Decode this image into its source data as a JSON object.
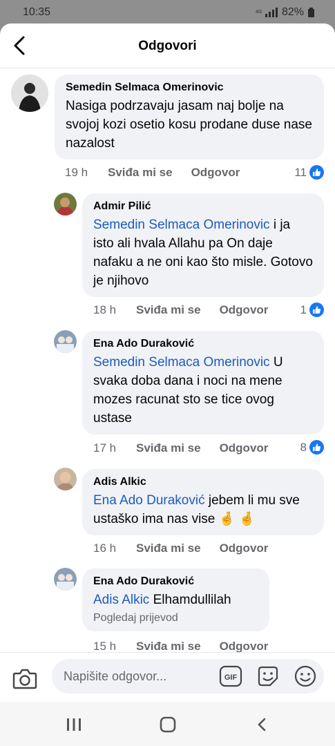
{
  "status_bar": {
    "time": "10:35",
    "battery": "82%"
  },
  "header": {
    "title": "Odgovori"
  },
  "comments": [
    {
      "name": "Semedin Selmaca Omerinovic",
      "text": "Nasiga podrzavaju jasam naj bolje na svojoj kozi osetio  kosu prodane duse nase  nazalost",
      "time": "19 h",
      "like_label": "Sviđa mi se",
      "reply_label": "Odgovor",
      "reactions": "11"
    },
    {
      "name": "Admir Pilić",
      "mention": "Semedin Selmaca Omerinovic",
      "text": " i ja isto ali hvala Allahu pa On daje nafaku a ne oni kao što misle. Gotovo je njihovo",
      "time": "18 h",
      "like_label": "Sviđa mi se",
      "reply_label": "Odgovor",
      "reactions": "1"
    },
    {
      "name": "Ena Ado Duraković",
      "mention": "Semedin Selmaca Omerinovic",
      "text": " U svaka doba dana i noci na mene mozes racunat sto se tice ovog ustase",
      "time": "17 h",
      "like_label": "Sviđa mi se",
      "reply_label": "Odgovor",
      "reactions": "8"
    },
    {
      "name": "Adis Alkic",
      "mention": "Ena Ado Duraković",
      "text": " jebem li mu sve ustaško ima nas vise",
      "emoji": "🤞 🤞",
      "time": "16 h",
      "like_label": "Sviđa mi se",
      "reply_label": "Odgovor"
    },
    {
      "name": "Ena Ado Duraković",
      "mention": "Adis Alkic",
      "text": " Elhamdullilah",
      "translate": "Pogledaj prijevod",
      "time": "15 h",
      "like_label": "Sviđa mi se",
      "reply_label": "Odgovor"
    }
  ],
  "composer": {
    "placeholder": "Napišite odgovor...",
    "gif": "GIF"
  },
  "colors": {
    "like_blue": "#1877f2",
    "mention": "#1b5bbf"
  }
}
